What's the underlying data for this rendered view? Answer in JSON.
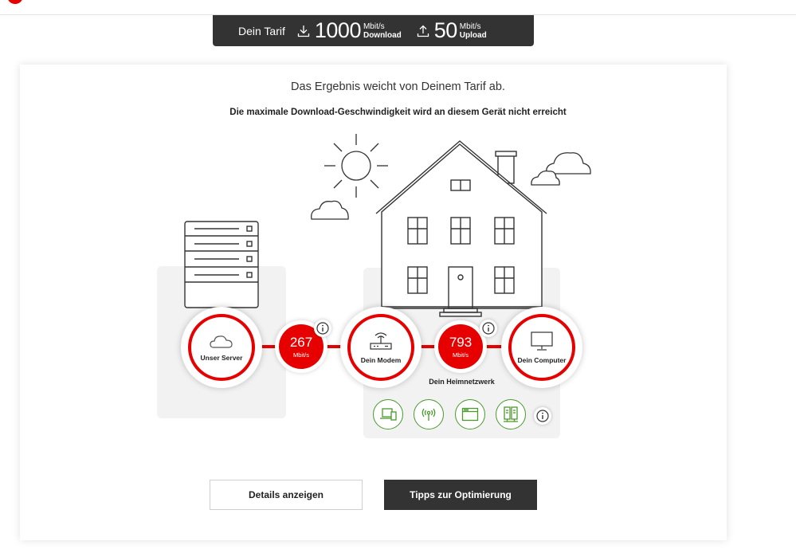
{
  "tariff": {
    "label": "Dein Tarif",
    "download_value": "1000",
    "download_unit": "Mbit/s",
    "download_label": "Download",
    "upload_value": "50",
    "upload_unit": "Mbit/s",
    "upload_label": "Upload"
  },
  "result": {
    "headline": "Das Ergebnis weicht von Deinem Tarif ab.",
    "subline": "Die maximale Download-Geschwindigkeit wird an diesem Gerät nicht erreicht"
  },
  "nodes": {
    "server": "Unser Server",
    "modem": "Dein Modem",
    "computer": "Dein Computer"
  },
  "speeds": {
    "server_to_modem": {
      "value": "267",
      "unit": "Mbit/s"
    },
    "modem_to_computer": {
      "value": "793",
      "unit": "Mbit/s"
    }
  },
  "home_network": {
    "label": "Dein Heimnetzwerk"
  },
  "buttons": {
    "details": "Details anzeigen",
    "tips": "Tipps zur Optimierung"
  },
  "colors": {
    "accent": "#e60000",
    "dark": "#333333",
    "device_green": "#4a9a2e"
  }
}
